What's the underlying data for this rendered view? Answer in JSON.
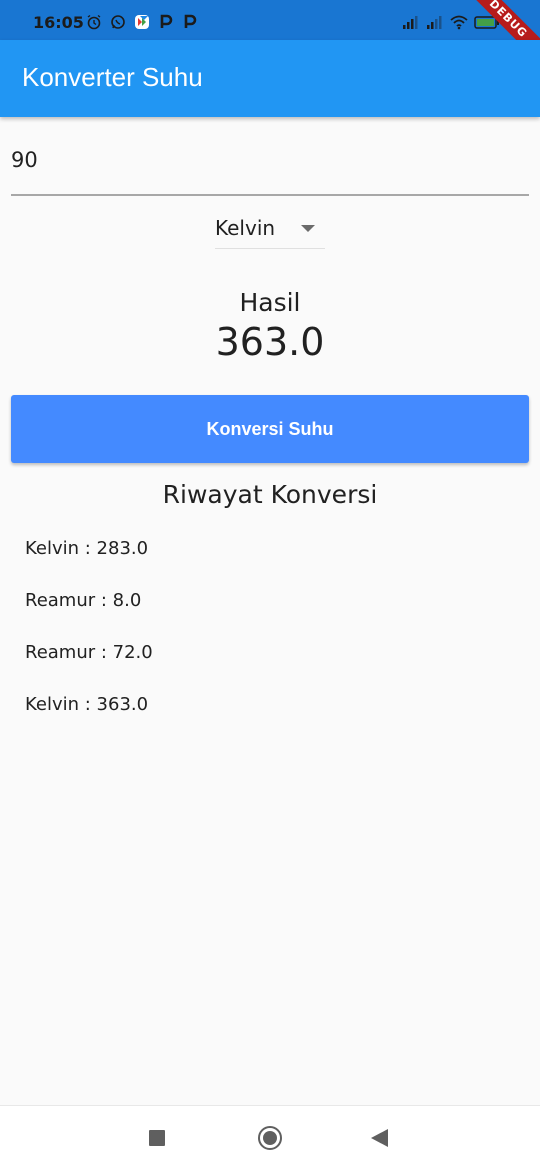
{
  "status_bar": {
    "time": "16:05",
    "left_icons": [
      "alarm-icon",
      "whatsapp-icon",
      "app-icon",
      "p-icon",
      "p-icon"
    ],
    "right_icons": [
      "signal-icon",
      "signal-icon",
      "wifi-icon",
      "battery-icon"
    ],
    "debug_label": "DEBUG"
  },
  "app_bar": {
    "title": "Konverter Suhu"
  },
  "input": {
    "value": "90"
  },
  "dropdown": {
    "selected": "Kelvin"
  },
  "result": {
    "label": "Hasil",
    "value": "363.0"
  },
  "convert_button": {
    "label": "Konversi Suhu"
  },
  "history": {
    "title": "Riwayat Konversi",
    "items": [
      "Kelvin : 283.0",
      "Reamur : 8.0",
      "Reamur : 72.0",
      "Kelvin : 363.0"
    ]
  },
  "colors": {
    "status_bar": "#1976d2",
    "app_bar": "#2196f3",
    "button": "#448aff",
    "background": "#fafafa"
  }
}
